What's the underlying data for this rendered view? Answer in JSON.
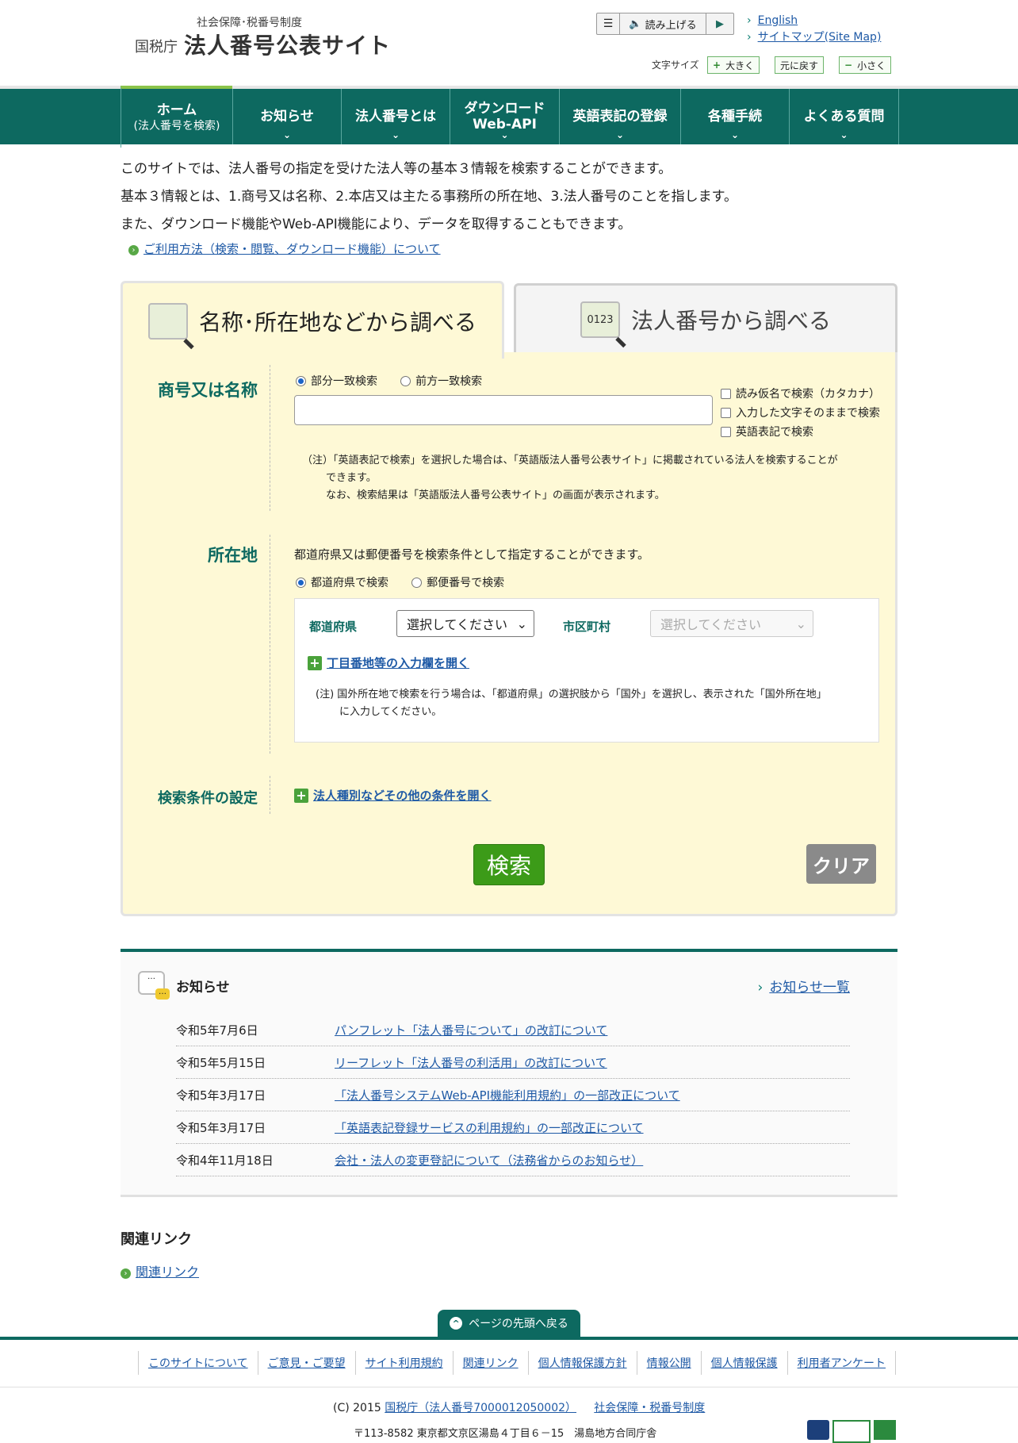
{
  "header": {
    "subtitle": "社会保障･税番号制度",
    "agency": "国税庁",
    "title": "法人番号公表サイト",
    "read_aloud": "読み上げる",
    "links": [
      "English",
      "サイトマップ(Site Map)"
    ],
    "font_size_label": "文字サイズ",
    "font_buttons": [
      {
        "sym": "+",
        "label": "大きく"
      },
      {
        "sym": "",
        "label": "元に戻す"
      },
      {
        "sym": "−",
        "label": "小さく"
      }
    ]
  },
  "nav": {
    "items": [
      {
        "line1": "ホーム",
        "line2": "(法人番号を検索)"
      },
      {
        "line1": "お知らせ",
        "line2": ""
      },
      {
        "line1": "法人番号とは",
        "line2": ""
      },
      {
        "line1": "ダウンロード",
        "line2": "Web-API"
      },
      {
        "line1": "英語表記の登録",
        "line2": ""
      },
      {
        "line1": "各種手続",
        "line2": ""
      },
      {
        "line1": "よくある質問",
        "line2": ""
      }
    ]
  },
  "intro": {
    "lines": [
      "このサイトでは、法人番号の指定を受けた法人等の基本３情報を検索することができます。",
      "基本３情報とは、1.商号又は名称、2.本店又は主たる事務所の所在地、3.法人番号のことを指します。",
      "また、ダウンロード機能やWeb-API機能により、データを取得することもできます。"
    ],
    "usage_link": "ご利用方法（検索・閲覧、ダウンロード機能）について"
  },
  "search": {
    "tabs": [
      "名称･所在地などから調べる",
      "法人番号から調べる"
    ],
    "tab_icon_text": "0123",
    "name_label": "商号又は名称",
    "name_radios": [
      "部分一致検索",
      "前方一致検索"
    ],
    "name_checks": [
      "読み仮名で検索（カタカナ）",
      "入力した文字そのままで検索",
      "英語表記で検索"
    ],
    "name_note_1": "（注）「英語表記で検索」を選択した場合は、「英語版法人番号公表サイト」に掲載されている法人を検索することが",
    "name_note_2": "できます。",
    "name_note_3": "なお、検索結果は「英語版法人番号公表サイト」の画面が表示されます。",
    "addr_label": "所在地",
    "addr_desc": "都道府県又は郵便番号を検索条件として指定することができます。",
    "addr_radios": [
      "都道府県で検索",
      "郵便番号で検索"
    ],
    "pref_label": "都道府県",
    "pref_value": "選択してください",
    "city_label": "市区町村",
    "city_value": "選択してください",
    "chome_link": "丁目番地等の入力欄を開く",
    "addr_note_1": "(注) 国外所在地で検索を行う場合は、「都道府県」の選択肢から「国外」を選択し、表示された「国外所在地」",
    "addr_note_2": "に入力してください。",
    "cond_label": "検索条件の設定",
    "cond_link": "法人種別などその他の条件を開く",
    "search_button": "検索",
    "clear_button": "クリア"
  },
  "news": {
    "title": "お知らせ",
    "all_link": "お知らせ一覧",
    "items": [
      {
        "date": "令和5年7月6日",
        "text": "パンフレット「法人番号について」の改訂について"
      },
      {
        "date": "令和5年5月15日",
        "text": "リーフレット「法人番号の利活用」の改訂について"
      },
      {
        "date": "令和5年3月17日",
        "text": "「法人番号システムWeb-API機能利用規約」の一部改正について"
      },
      {
        "date": "令和5年3月17日",
        "text": "「英語表記登録サービスの利用規約」の一部改正について"
      },
      {
        "date": "令和4年11月18日",
        "text": "会社・法人の変更登記について（法務省からのお知らせ）"
      }
    ]
  },
  "related": {
    "title": "関連リンク",
    "link": "関連リンク"
  },
  "footer": {
    "page_top": "ページの先頭へ戻る",
    "links": [
      "このサイトについて",
      "ご意見・ご要望",
      "サイト利用規約",
      "関連リンク",
      "個人情報保護方針",
      "情報公開",
      "個人情報保護",
      "利用者アンケート"
    ],
    "copyright_prefix": "(C) 2015",
    "copyright_link1": "国税庁（法人番号7000012050002）",
    "copyright_link2": "社会保障・税番号制度",
    "address": "〒113-8582 東京都文京区湯島４丁目６－15　湯島地方合同庁舎"
  },
  "colors": {
    "brand": "#0d6960",
    "panel": "#fef9d6",
    "search_button": "#3c9b18"
  }
}
